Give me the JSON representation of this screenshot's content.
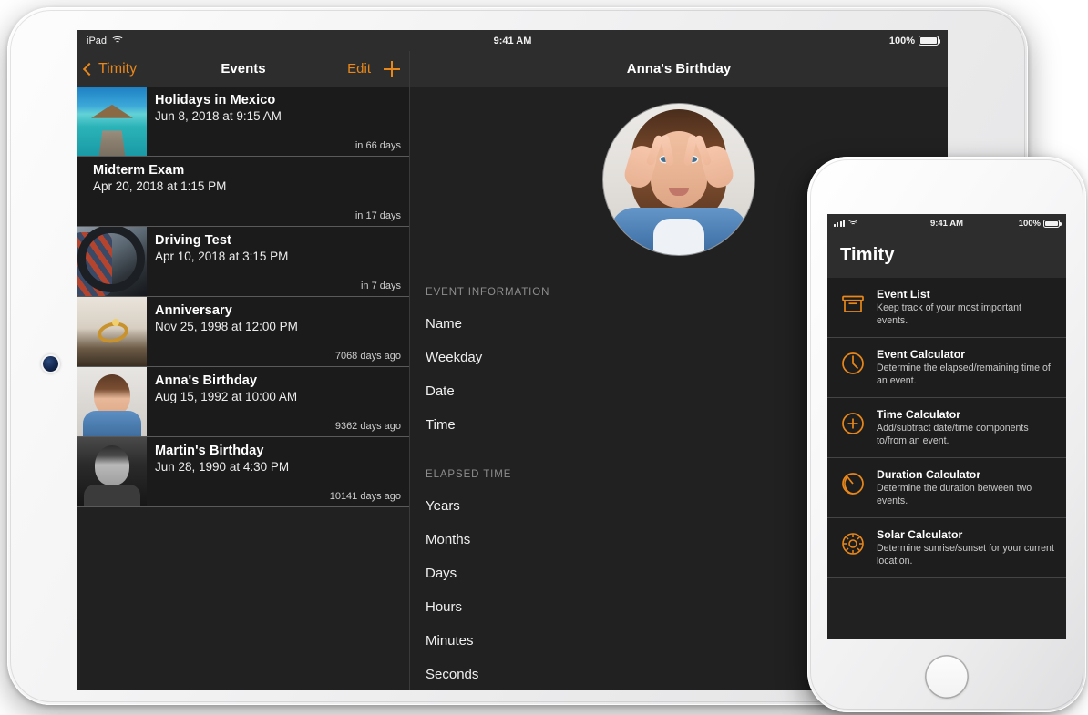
{
  "colors": {
    "accent": "#e8871a",
    "screen_bg": "#212121",
    "bar_bg": "#2d2d2d",
    "row_bg": "#1b1b1b"
  },
  "ipad": {
    "status": {
      "device_label": "iPad",
      "wifi_icon": "wifi-icon",
      "time": "9:41 AM",
      "battery_percent": "100%",
      "battery_icon": "battery-icon"
    },
    "master": {
      "back_label": "Timity",
      "back_icon": "chevron-left-icon",
      "title": "Events",
      "edit_label": "Edit",
      "add_icon": "plus-icon",
      "events": [
        {
          "title": "Holidays in Mexico",
          "date": "Jun 8, 2018 at 9:15 AM",
          "relative": "in 66 days",
          "thumb": "beach-photo",
          "has_thumb": true
        },
        {
          "title": "Midterm Exam",
          "date": "Apr 20, 2018 at 1:15 PM",
          "relative": "in 17 days",
          "thumb": "",
          "has_thumb": false
        },
        {
          "title": "Driving Test",
          "date": "Apr 10, 2018 at 3:15 PM",
          "relative": "in 7 days",
          "thumb": "driving-photo",
          "has_thumb": true
        },
        {
          "title": "Anniversary",
          "date": "Nov 25, 1998 at 12:00 PM",
          "relative": "7068 days ago",
          "thumb": "rings-photo",
          "has_thumb": true
        },
        {
          "title": "Anna's Birthday",
          "date": "Aug 15, 1992 at 10:00 AM",
          "relative": "9362 days ago",
          "thumb": "anna-photo",
          "has_thumb": true
        },
        {
          "title": "Martin's Birthday",
          "date": "Jun 28, 1990 at 4:30 PM",
          "relative": "10141 days ago",
          "thumb": "martin-photo",
          "has_thumb": true
        }
      ]
    },
    "detail": {
      "title": "Anna's Birthday",
      "avatar_name": "anna-avatar",
      "sections": [
        {
          "header": "EVENT INFORMATION",
          "rows": [
            "Name",
            "Weekday",
            "Date",
            "Time"
          ]
        },
        {
          "header": "ELAPSED TIME",
          "rows": [
            "Years",
            "Months",
            "Days",
            "Hours",
            "Minutes",
            "Seconds"
          ]
        }
      ]
    }
  },
  "iphone": {
    "status": {
      "signal_icon": "signal-bars-icon",
      "wifi_icon": "wifi-icon",
      "time": "9:41 AM",
      "battery_percent": "100%",
      "battery_icon": "battery-icon"
    },
    "app_title": "Timity",
    "menu": [
      {
        "icon": "archive-box-icon",
        "title": "Event List",
        "desc": "Keep track of your most important events."
      },
      {
        "icon": "clock-icon",
        "title": "Event Calculator",
        "desc": "Determine the elapsed/remaining time of an event."
      },
      {
        "icon": "plus-circle-icon",
        "title": "Time Calculator",
        "desc": "Add/subtract date/time components to/from an event."
      },
      {
        "icon": "pie-slice-icon",
        "title": "Duration Calculator",
        "desc": "Determine the duration between two events."
      },
      {
        "icon": "sun-icon",
        "title": "Solar Calculator",
        "desc": "Determine sunrise/sunset for your current location."
      }
    ]
  }
}
